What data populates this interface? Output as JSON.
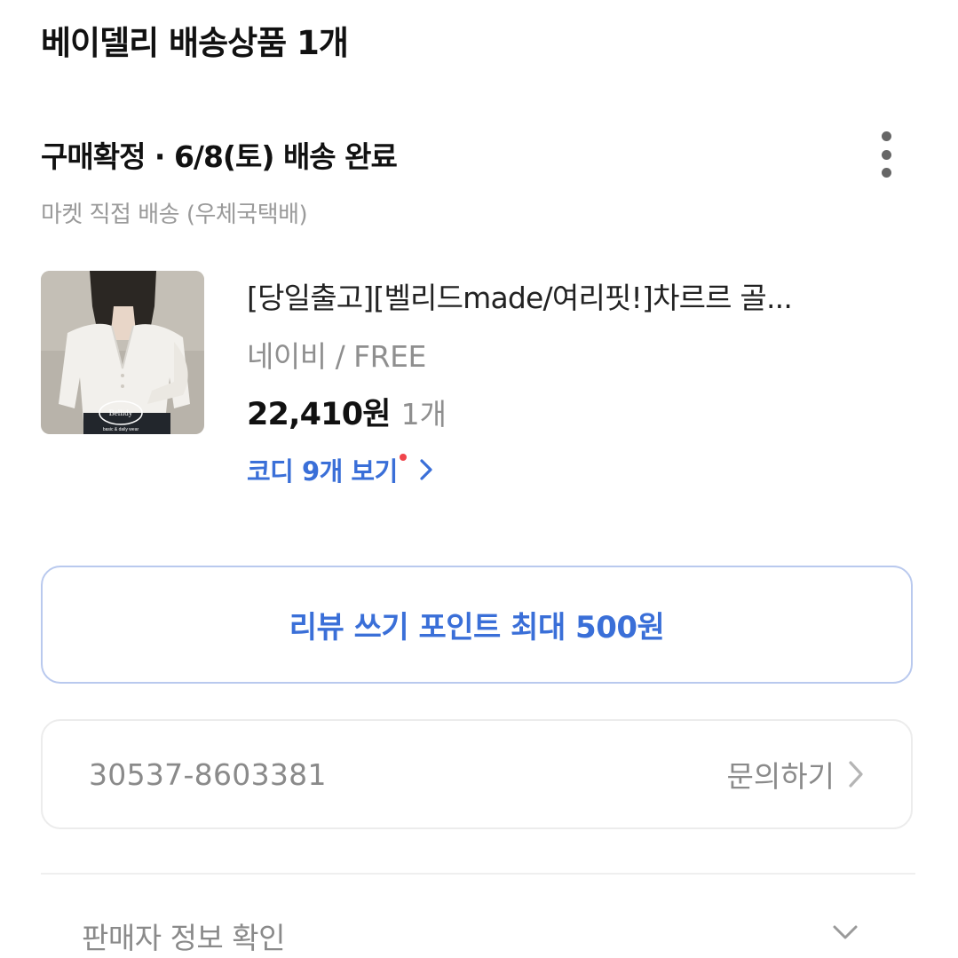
{
  "store": {
    "title": "베이델리 배송상품 1개"
  },
  "order": {
    "status": "구매확정 · 6/8(토) 배송 완료",
    "delivery_method": "마켓 직접 배송 (우체국택배)"
  },
  "product": {
    "name": "[당일출고][벨리드made/여리핏!]차르르 골...",
    "option": "네이비 / FREE",
    "price": "22,410원",
    "quantity": "1개",
    "image_brand": "Bellidy",
    "image_brand_sub": "basic & daily wear"
  },
  "codi": {
    "label": "코디 9개 보기"
  },
  "review": {
    "button_label": "리뷰 쓰기 포인트 최대 500원"
  },
  "order_box": {
    "order_number": "30537-8603381",
    "inquiry_label": "문의하기"
  },
  "seller": {
    "label": "판매자 정보 확인"
  },
  "colors": {
    "accent": "#3a6fd8",
    "badge_dot": "#f0444b",
    "muted": "#8a8a8a"
  },
  "icons": {
    "more": "more-vertical-icon",
    "chevron_right": "chevron-right-icon",
    "chevron_down": "chevron-down-icon"
  }
}
